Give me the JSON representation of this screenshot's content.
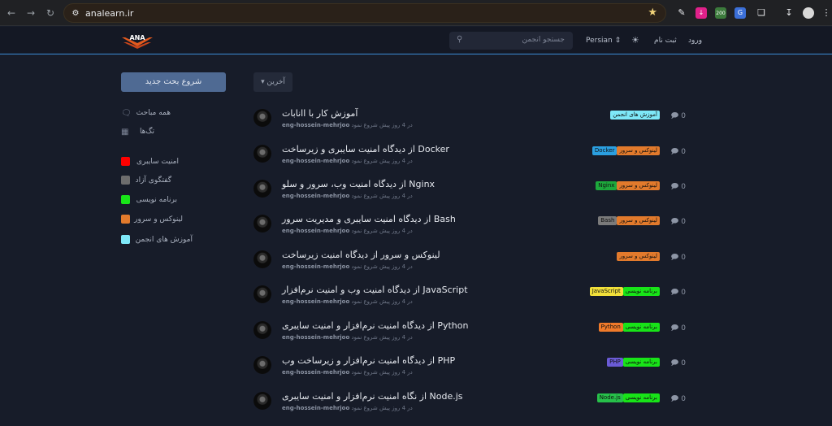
{
  "browser": {
    "url": "analearn.ir",
    "back_icon": "arrow-left-icon",
    "forward_icon": "arrow-right-icon",
    "reload_icon": "reload-icon",
    "ext_badge": "200"
  },
  "header": {
    "logo_text": "ANA",
    "search_placeholder": "جستجو انجمن",
    "language": "Persian",
    "signup": "ثبت نام",
    "login": "ورود"
  },
  "sidebar": {
    "start_button": "شروع بحث جدید",
    "all_discussions": "همه مباحث",
    "tags": "تگ‌ها",
    "categories": [
      {
        "label": "امنیت سایبری",
        "color": "#ff0000"
      },
      {
        "label": "گفتگوی آزاد",
        "color": "#6d6d6d"
      },
      {
        "label": "برنامه نویسی",
        "color": "#18e418"
      },
      {
        "label": "لینوکس و سرور",
        "color": "#e27a2c"
      },
      {
        "label": "آموزش های انجمن",
        "color": "#7ee8f8"
      }
    ]
  },
  "sort_label": "آخرین",
  "discussions": [
    {
      "title": "آموزش کار با اانابات",
      "user": "eng-hossein-mehrjoo",
      "time": "در 4 روز پیش شروع نمود",
      "replies": "0",
      "tags": [
        {
          "label": "آموزش های انجمن",
          "color": "#7ee8f8"
        }
      ]
    },
    {
      "title": "از دیدگاه امنیت سایبری و زیرساخت Docker",
      "user": "eng-hossein-mehrjoo",
      "time": "در 4 روز پیش شروع نمود",
      "replies": "0",
      "tags": [
        {
          "label": "Docker",
          "color": "#2b9fe0"
        },
        {
          "label": "لینوکس و سرور",
          "color": "#e27a2c"
        }
      ]
    },
    {
      "title": "از دیدگاه امنیت وب، سرور و سلو Nginx",
      "user": "eng-hossein-mehrjoo",
      "time": "در 4 روز پیش شروع نمود",
      "replies": "0",
      "tags": [
        {
          "label": "Nginx",
          "color": "#1da93c"
        },
        {
          "label": "لینوکس و سرور",
          "color": "#e27a2c"
        }
      ]
    },
    {
      "title": "از دیدگاه امنیت سایبری و مدیریت سرور Bash",
      "user": "eng-hossein-mehrjoo",
      "time": "در 4 روز پیش شروع نمود",
      "replies": "0",
      "tags": [
        {
          "label": "Bash",
          "color": "#7a7a7a"
        },
        {
          "label": "لینوکس و سرور",
          "color": "#e27a2c"
        }
      ]
    },
    {
      "title": "لینوکس و سرور از دیدگاه امنیت زیرساخت",
      "user": "eng-hossein-mehrjoo",
      "time": "در 4 روز پیش شروع نمود",
      "replies": "0",
      "tags": [
        {
          "label": "لینوکس و سرور",
          "color": "#e27a2c"
        }
      ]
    },
    {
      "title": "از دیدگاه امنیت وب و امنیت نرم‌افزار JavaScript",
      "user": "eng-hossein-mehrjoo",
      "time": "در 4 روز پیش شروع نمود",
      "replies": "0",
      "tags": [
        {
          "label": "JavaScript",
          "color": "#f2e03a"
        },
        {
          "label": "برنامه نویسی",
          "color": "#18e418"
        }
      ]
    },
    {
      "title": "از دیدگاه امنیت نرم‌افزار و امنیت سایبری Python",
      "user": "eng-hossein-mehrjoo",
      "time": "در 4 روز پیش شروع نمود",
      "replies": "0",
      "tags": [
        {
          "label": "Python",
          "color": "#f07a2a"
        },
        {
          "label": "برنامه نویسی",
          "color": "#18e418"
        }
      ]
    },
    {
      "title": "از دیدگاه امنیت نرم‌افزار و زیرساخت وب PHP",
      "user": "eng-hossein-mehrjoo",
      "time": "در 4 روز پیش شروع نمود",
      "replies": "0",
      "tags": [
        {
          "label": "PHP",
          "color": "#6b5bd6"
        },
        {
          "label": "برنامه نویسی",
          "color": "#18e418"
        }
      ]
    },
    {
      "title": "از نگاه امنیت نرم‌افزار و امنیت سایبری Node.js",
      "user": "eng-hossein-mehrjoo",
      "time": "در 4 روز پیش شروع نمود",
      "replies": "0",
      "tags": [
        {
          "label": "Node.js",
          "color": "#27c04a"
        },
        {
          "label": "برنامه نویسی",
          "color": "#18e418"
        }
      ]
    }
  ]
}
